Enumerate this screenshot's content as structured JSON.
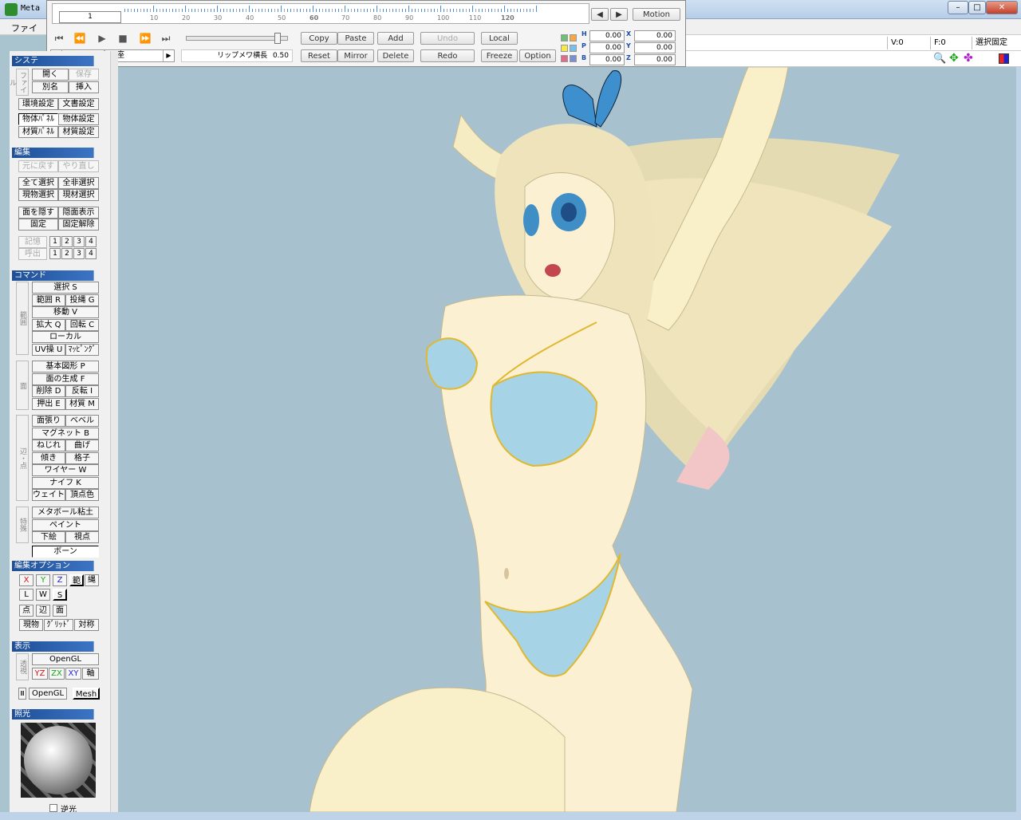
{
  "window": {
    "title": "Meta",
    "menu_first": "ファイ"
  },
  "toolbar": {
    "frame_value": "1",
    "tick_labels": [
      "10",
      "20",
      "30",
      "40",
      "50",
      "60",
      "70",
      "80",
      "90",
      "100",
      "110",
      "120"
    ],
    "prev_label": "◀",
    "next_label": "▶",
    "motion_label": "Motion",
    "copy": "Copy",
    "paste": "Paste",
    "add": "Add",
    "undo": "Undo",
    "local": "Local",
    "reset": "Reset",
    "mirror": "Mirror",
    "delete": "Delete",
    "redo": "Redo",
    "freeze": "Freeze",
    "option": "Option",
    "posture": "土下座",
    "lip_label": "リップメワ横長",
    "lip_value": "0.50",
    "slider_level": 0.9,
    "hpb": {
      "h": "H",
      "p": "P",
      "b": "B",
      "x": "X",
      "y": "Y",
      "z": "Z"
    },
    "values": {
      "h": "0.00",
      "p": "0.00",
      "b": "0.00",
      "x": "0.00",
      "y": "0.00",
      "z": "0.00"
    },
    "colors": [
      "#6fbf73",
      "#f5a742",
      "#f6e84a",
      "#79c0e8",
      "#e06b8c",
      "#7a8fd0"
    ]
  },
  "status": {
    "v": "V:0",
    "f": "F:0",
    "mode": "選択固定"
  },
  "left": {
    "system": "システ",
    "file_side": "ファイル",
    "open": "開く",
    "save": "保存",
    "alias": "別名",
    "insert": "挿入",
    "env": "環境設定",
    "doc": "文書設定",
    "objpanel": "物体ﾊﾟﾈﾙ",
    "objset": "物体設定",
    "matpanel": "材質ﾊﾟﾈﾙ",
    "matset": "材質設定",
    "edit": "編集",
    "undo": "元に戻す",
    "redo": "やり直し",
    "selall": "全て選択",
    "unselall": "全非選択",
    "curobjsel": "現物選択",
    "curmatsel": "現材選択",
    "hide": "面を隠す",
    "showhidden": "隠面表示",
    "fix": "固定",
    "unfix": "固定解除",
    "memory": "記憶",
    "recall": "呼出",
    "nums": [
      "1",
      "2",
      "3",
      "4"
    ],
    "command": "コマンド",
    "range_side": "範囲",
    "select": "選択 S",
    "rangeR": "範囲 R",
    "lasso": "投縄 G",
    "move": "移動 V",
    "scale": "拡大 Q",
    "rotate": "回転 C",
    "local": "ローカル",
    "uv": "UV操 U",
    "mapping": "ﾏｯﾋﾟﾝｸﾞ",
    "face_side": "面",
    "basic": "基本図形 P",
    "genface": "面の生成 F",
    "del": "削除 D",
    "invert": "反転 I",
    "extrude": "押出 E",
    "material": "材質 M",
    "edge_side": "辺・点",
    "facestretch": "面張り",
    "bevel": "ベベル",
    "magnet": "マグネット B",
    "twist": "ねじれ",
    "bend": "曲げ",
    "tilt": "傾き",
    "lattice": "格子",
    "wire": "ワイヤー W",
    "knife": "ナイフ K",
    "weight": "ウェイト",
    "vcolor": "頂点色",
    "special_side": "特殊",
    "metaball": "メタボール粘土",
    "paint": "ペイント",
    "underlay": "下絵",
    "view": "視点",
    "bone": "ボーン",
    "editopt": "編集オプション",
    "x": "X",
    "y": "Y",
    "z": "Z",
    "range": "範",
    "rope": "縄",
    "l": "L",
    "w": "W",
    "s": "S",
    "pt": "点",
    "edge": "辺",
    "face": "面",
    "curobj": "現物",
    "grid": "ｸﾞﾘｯﾄﾞ",
    "sym": "対称",
    "display": "表示",
    "persp_side": "透視",
    "opengl": "OpenGL",
    "yz": "YZ",
    "zx": "ZX",
    "xy": "XY",
    "axis": "軸",
    "opengl2": "OpenGL",
    "mesh": "Mesh",
    "lighting": "照光",
    "backlight": "逆光"
  }
}
